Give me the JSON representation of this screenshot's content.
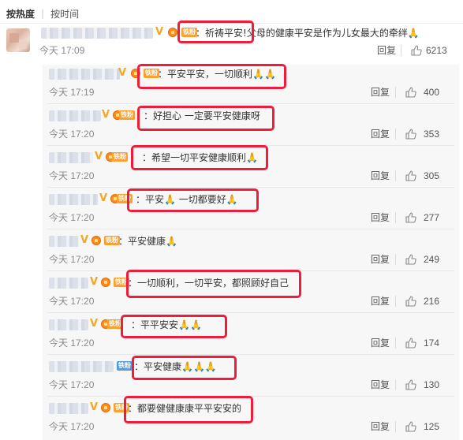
{
  "sort_tabs": {
    "active": "按热度",
    "other": "按时间"
  },
  "main_comment": {
    "fan_badge": "铁粉",
    "text_part1": "：祈祷平安!",
    "text_part2": "父母的健康平安是作为儿女最大的牵绊",
    "emoji": "🙏",
    "time": "今天 17:09",
    "reply_label": "回复",
    "likes": "6213"
  },
  "replies": [
    {
      "fan_badge": "铁粉",
      "text": "：平安平安，一切顺利🙏🙏",
      "time": "今天 17:19",
      "reply_label": "回复",
      "likes": "400"
    },
    {
      "fan_badge": "铁粉",
      "text": "：好担心 一定要平安健康呀",
      "time": "今天 17:20",
      "reply_label": "回复",
      "likes": "353"
    },
    {
      "fan_badge": "铁粉",
      "text": "：希望一切平安健康顺利🙏",
      "time": "今天 17:20",
      "reply_label": "回复",
      "likes": "305"
    },
    {
      "fan_badge": "铁粉",
      "text": "：平安🙏 一切都要好🙏",
      "time": "今天 17:20",
      "reply_label": "回复",
      "likes": "277"
    },
    {
      "fan_badge": "铁粉",
      "text": "：平安健康🙏",
      "time": "今天 17:20",
      "reply_label": "回复",
      "likes": "249"
    },
    {
      "fan_badge": "铁粉",
      "text": "：一切顺利，一切平安，都照顾好自己",
      "time": "今天 17:20",
      "reply_label": "回复",
      "likes": "216"
    },
    {
      "fan_badge": "铁粉",
      "text": "：平平安安🙏🙏",
      "time": "今天 17:20",
      "reply_label": "回复",
      "likes": "174"
    },
    {
      "fan_badge": "铁粉",
      "text": "：平安健康🙏🙏🙏",
      "time": "今天 17:20",
      "reply_label": "回复",
      "likes": "130"
    },
    {
      "fan_badge": "铁粉",
      "text": "：都要健健康康平平安安的",
      "time": "今天 17:20",
      "reply_label": "回复",
      "likes": "125"
    }
  ],
  "colors": {
    "highlight_box": "#ee1d3a",
    "verified_v": "#f5a623",
    "fan_badge": "#ff9f2e",
    "reply_panel_bg": "#f7f7f7"
  },
  "icons": {
    "like": "thumbs-up-icon",
    "verified": "verified-v-icon",
    "crown": "crown-icon"
  }
}
